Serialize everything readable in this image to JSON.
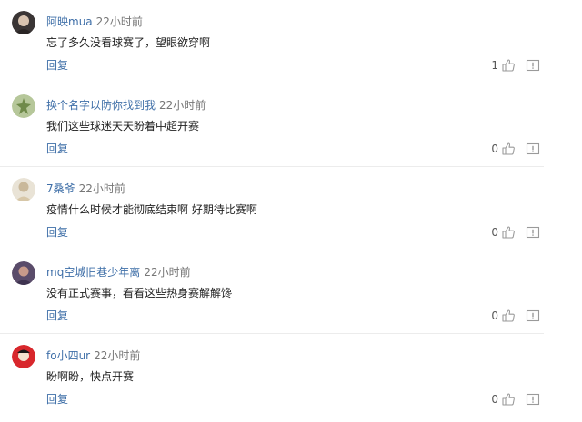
{
  "comments": [
    {
      "username": "阿映mua",
      "time": "22小时前",
      "content": "忘了多久没看球赛了，望眼欲穿啊",
      "reply_label": "回复",
      "likes": "1",
      "avatar_colors": [
        "#3a3535",
        "#d8c3b0"
      ]
    },
    {
      "username": "换个名字以防你找到我",
      "time": "22小时前",
      "content": "我们这些球迷天天盼着中超开赛",
      "reply_label": "回复",
      "likes": "0",
      "avatar_colors": [
        "#b6c79a",
        "#6f8a4a"
      ]
    },
    {
      "username": "7桑爷",
      "time": "22小时前",
      "content": "疫情什么时候才能彻底结束啊 好期待比赛啊",
      "reply_label": "回复",
      "likes": "0",
      "avatar_colors": [
        "#e9e3d6",
        "#c9b89a"
      ]
    },
    {
      "username": "mq空城旧巷少年离",
      "time": "22小时前",
      "content": "没有正式赛事，看看这些热身赛解解馋",
      "reply_label": "回复",
      "likes": "0",
      "avatar_colors": [
        "#5a4c6a",
        "#c89a8a"
      ]
    },
    {
      "username": "fo小四ur",
      "time": "22小时前",
      "content": "盼啊盼，快点开赛",
      "reply_label": "回复",
      "likes": "0",
      "avatar_colors": [
        "#d8272c",
        "#f3e3d0"
      ]
    }
  ],
  "icons": {
    "like": "thumbs-up-icon",
    "report": "report-icon"
  },
  "colors": {
    "username": "#3f6fa8",
    "reply": "#3f6fa8",
    "timestamp": "#777777",
    "divider": "#ececec"
  }
}
